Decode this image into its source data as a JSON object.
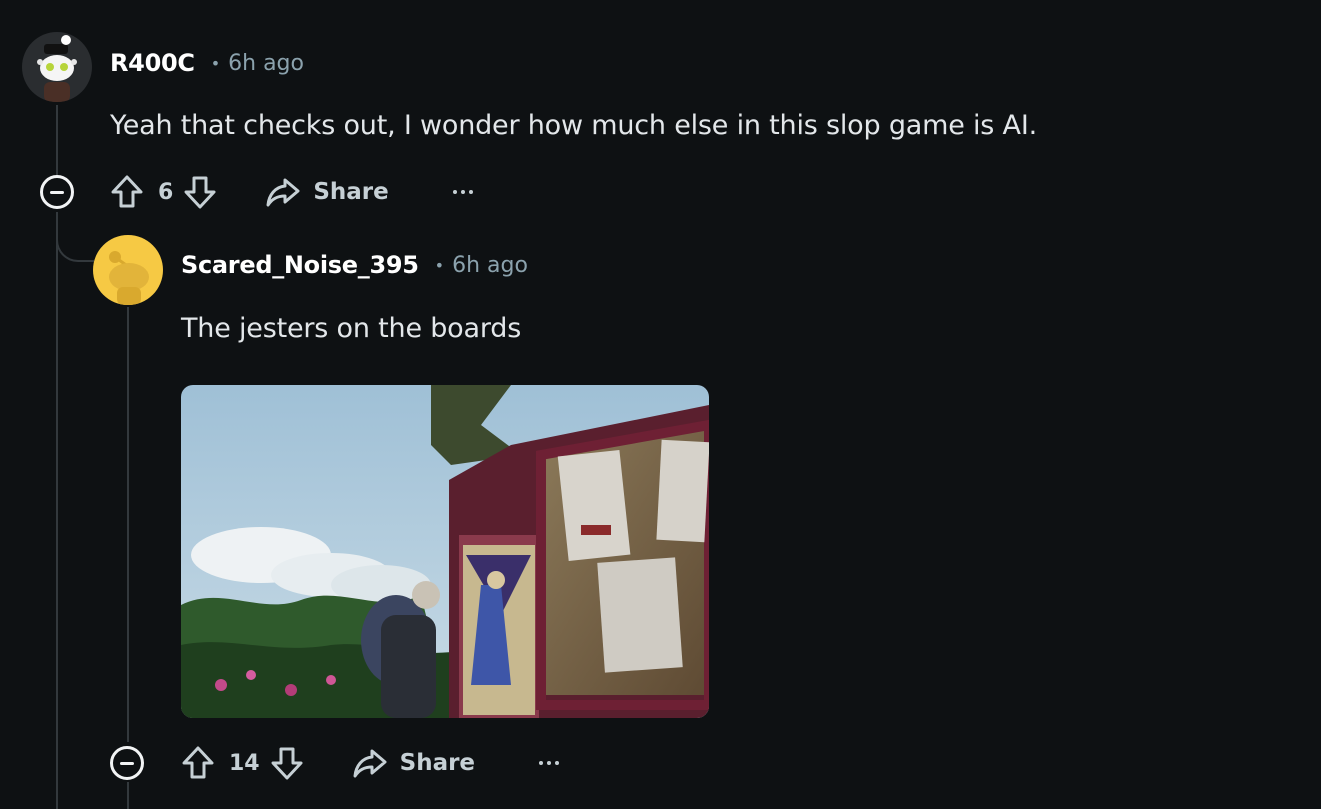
{
  "comments": [
    {
      "username": "R400C",
      "separator": "•",
      "time": "6h ago",
      "text": "Yeah that checks out, I wonder how much else in this slop game is AI.",
      "score": "6",
      "share_label": "Share",
      "avatar_icon": "snoo-avatar-icon",
      "avatar_color": "#2a2d30"
    },
    {
      "username": "Scared_Noise_395",
      "separator": "•",
      "time": "6h ago",
      "text": "The jesters on the boards",
      "score": "14",
      "share_label": "Share",
      "avatar_icon": "snoo-default-icon",
      "avatar_color": "#f6c944",
      "image_alt": "Game screenshot of a character standing by a notice board painted with jesters"
    }
  ],
  "colors": {
    "background": "#0e1113",
    "thread_line": "#33393d",
    "meta_text": "#8ba2ad"
  }
}
